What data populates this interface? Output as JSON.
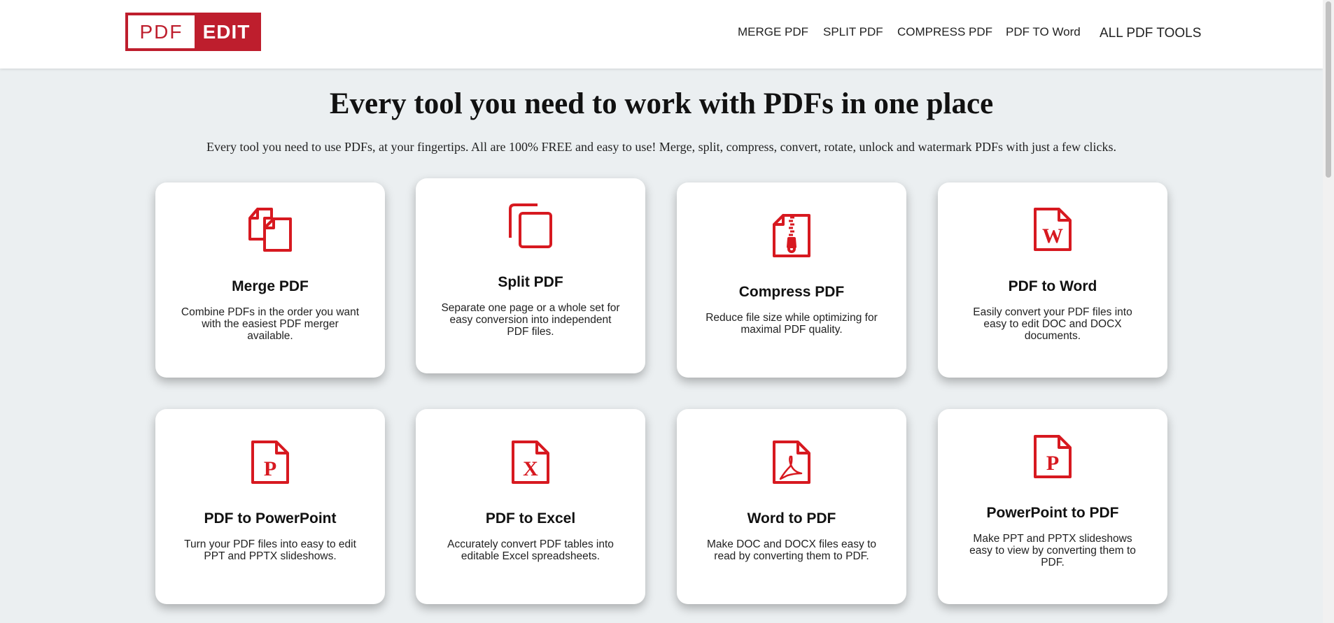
{
  "logo": {
    "left_text": "PDF",
    "right_text": "EDIT"
  },
  "nav": {
    "merge": "MERGE PDF",
    "split": "SPLIT PDF",
    "compress": "COMPRESS PDF",
    "to_word": "PDF TO Word",
    "all": "ALL PDF TOOLS"
  },
  "hero": {
    "title": "Every tool you need to work with PDFs in one place",
    "subtitle": "Every tool you need to use PDFs, at your fingertips. All are 100% FREE and easy to use! Merge, split, compress, convert, rotate, unlock and watermark PDFs with just a few clicks."
  },
  "tools": [
    {
      "icon": "merge-icon",
      "title": "Merge PDF",
      "desc": "Combine PDFs in the order you want with the easiest PDF merger available."
    },
    {
      "icon": "split-icon",
      "title": "Split PDF",
      "desc": "Separate one page or a whole set for easy conversion into independent PDF files."
    },
    {
      "icon": "compress-icon",
      "title": "Compress PDF",
      "desc": "Reduce file size while optimizing for maximal PDF quality."
    },
    {
      "icon": "word-file-icon",
      "title": "PDF to Word",
      "desc": "Easily convert your PDF files into easy to edit DOC and DOCX documents."
    },
    {
      "icon": "powerpoint-file-icon",
      "title": "PDF to PowerPoint",
      "desc": "Turn your PDF files into easy to edit PPT and PPTX slideshows."
    },
    {
      "icon": "excel-file-icon",
      "title": "PDF to Excel",
      "desc": "Accurately convert PDF tables into editable Excel spreadsheets."
    },
    {
      "icon": "pdf-file-icon",
      "title": "Word to PDF",
      "desc": "Make DOC and DOCX files easy to read by converting them to PDF."
    },
    {
      "icon": "powerpoint-file-icon",
      "title": "PowerPoint to PDF",
      "desc": "Make PPT and PPTX slideshows easy to view by converting them to PDF."
    }
  ],
  "colors": {
    "brand_red": "#be1e2d",
    "icon_red": "#d71920",
    "background": "#ebeff1"
  }
}
